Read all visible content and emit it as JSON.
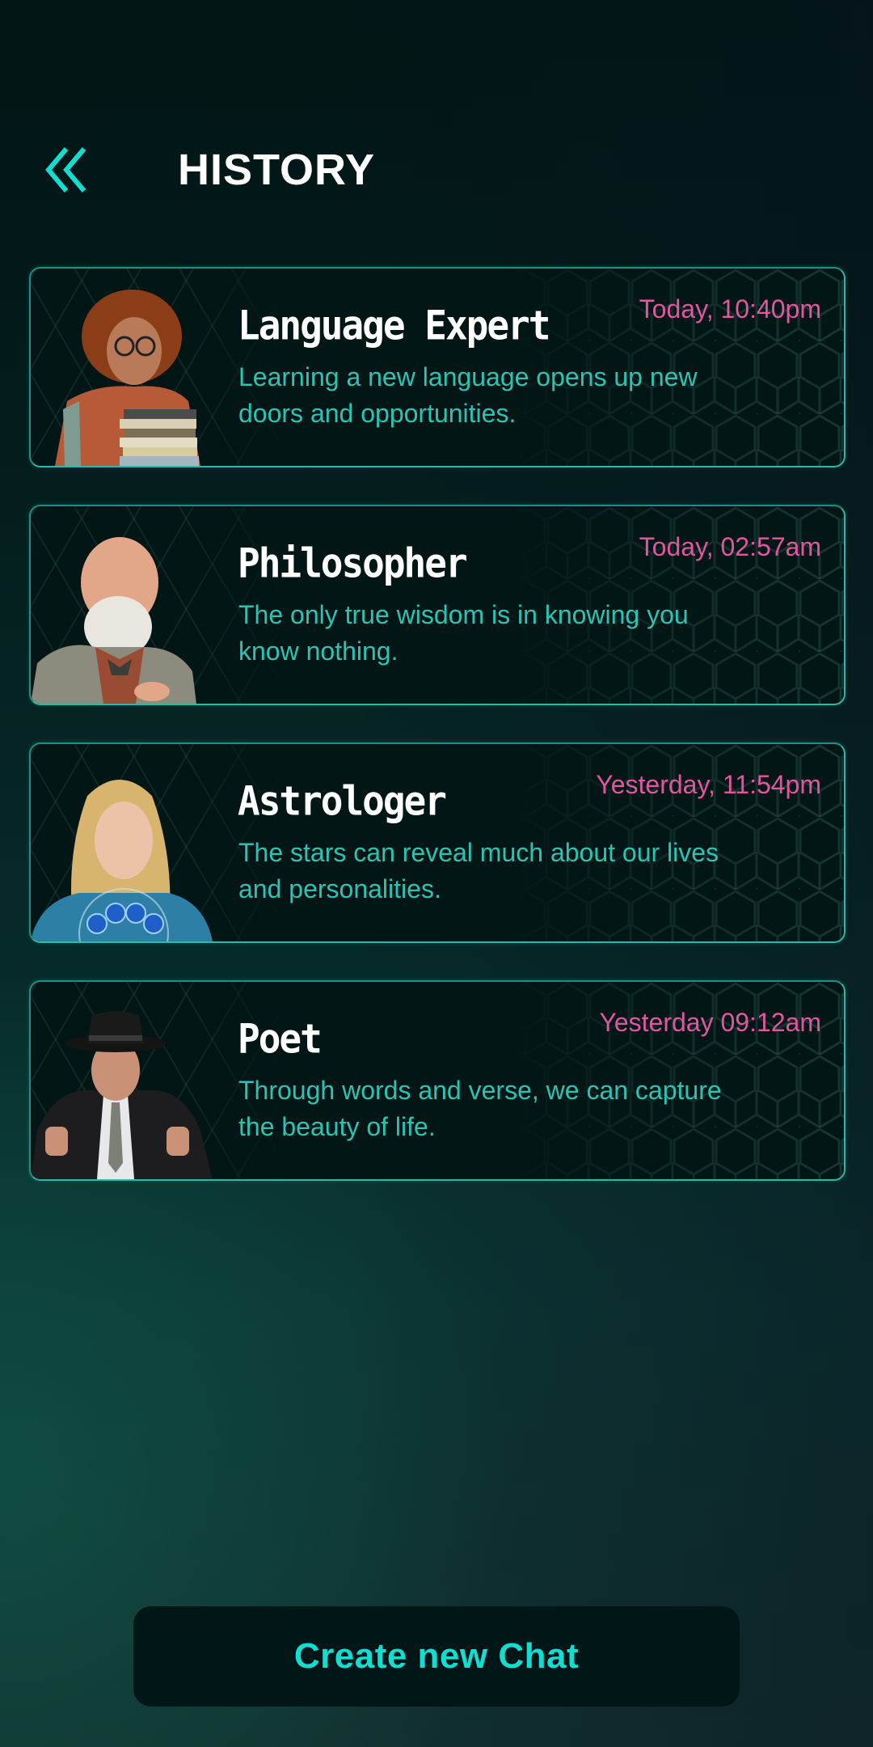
{
  "header": {
    "back_icon": "double-chevron-left-icon",
    "title": "HISTORY"
  },
  "colors": {
    "accent": "#12ddd0",
    "timestamp": "#e2559f",
    "message": "#2bc4b4",
    "card_border": "#2fb7a9",
    "card_bg": "#031616"
  },
  "history": [
    {
      "name": "Language Expert",
      "time": "Today, 10:40pm",
      "message": "Learning a new language opens up new doors and opportunities.",
      "avatar": "woman-with-books-avatar"
    },
    {
      "name": "Philosopher",
      "time": "Today, 02:57am",
      "message": "The only true wisdom is in knowing you know nothing.",
      "avatar": "bearded-old-man-avatar"
    },
    {
      "name": "Astrologer",
      "time": "Yesterday, 11:54pm",
      "message": "The stars can reveal much about our lives and personalities.",
      "avatar": "woman-with-zodiac-orbs-avatar"
    },
    {
      "name": "Poet",
      "time": "Yesterday 09:12am",
      "message": "Through words and verse, we can capture the beauty of life.",
      "avatar": "man-in-fedora-avatar"
    }
  ],
  "footer": {
    "create_label": "Create new Chat"
  }
}
